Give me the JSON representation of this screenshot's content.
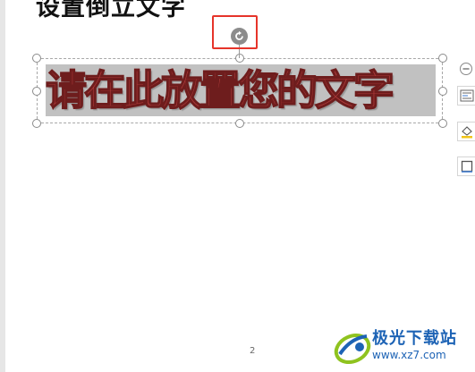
{
  "document": {
    "heading": "设置倒立文字",
    "wordart_text": "请在此放置您的文字",
    "page_number": "2"
  },
  "colors": {
    "wordart_fill": "#b73e3e",
    "highlight_box": "#e6342a",
    "watermark_blue": "#1d63b5"
  },
  "side_toolbar": [
    {
      "icon": "zoom-out-icon"
    },
    {
      "icon": "text-wrap-icon"
    },
    {
      "icon": "fill-icon"
    },
    {
      "icon": "frame-icon"
    }
  ],
  "watermark": {
    "title": "极光下载站",
    "url": "www.xz7.com"
  }
}
